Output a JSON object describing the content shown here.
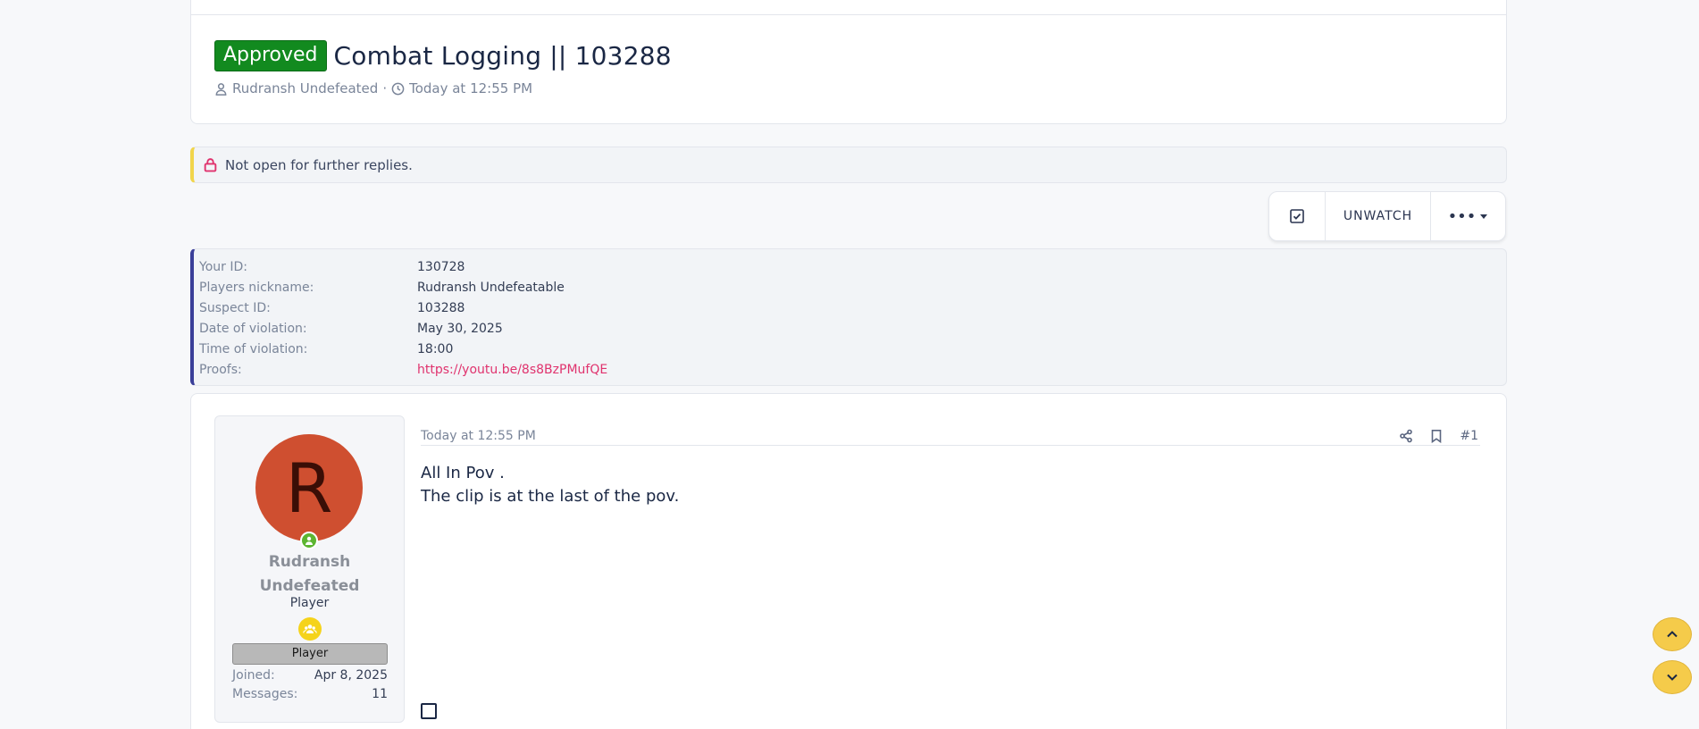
{
  "thread": {
    "prefix": "Approved",
    "title": "Combat Logging || 103288",
    "author": "Rudransh Undefeated",
    "separator": "·",
    "date": "Today at 12:55 PM"
  },
  "notice": {
    "text": "Not open for further replies."
  },
  "toolbar": {
    "unwatch_label": "UNWATCH",
    "more_label": "•••"
  },
  "fields": [
    {
      "label": "Your ID:",
      "value": "130728"
    },
    {
      "label": "Players nickname:",
      "value": "Rudransh Undefeatable"
    },
    {
      "label": "Suspect ID:",
      "value": "103288"
    },
    {
      "label": "Date of violation:",
      "value": "May 30, 2025"
    },
    {
      "label": "Time of violation:",
      "value": "18:00"
    },
    {
      "label": "Proofs:",
      "value": "https://youtu.be/8s8BzPMufQE"
    }
  ],
  "post": {
    "date": "Today at 12:55 PM",
    "number": "#1",
    "lines": [
      "All In Pov .",
      "The clip is at the last of the pov."
    ]
  },
  "user": {
    "avatar_letter": "R",
    "name_line1": "Rudransh",
    "name_line2": "Undefeated",
    "title": "Player",
    "banner": "Player",
    "joined_label": "Joined:",
    "joined_value": "Apr 8, 2025",
    "messages_label": "Messages:",
    "messages_value": "11"
  },
  "colors": {
    "approved": "#128a1f",
    "link": "#e0336e",
    "avatar": "#cf4f30",
    "scroll_button": "#f5cb4a"
  }
}
